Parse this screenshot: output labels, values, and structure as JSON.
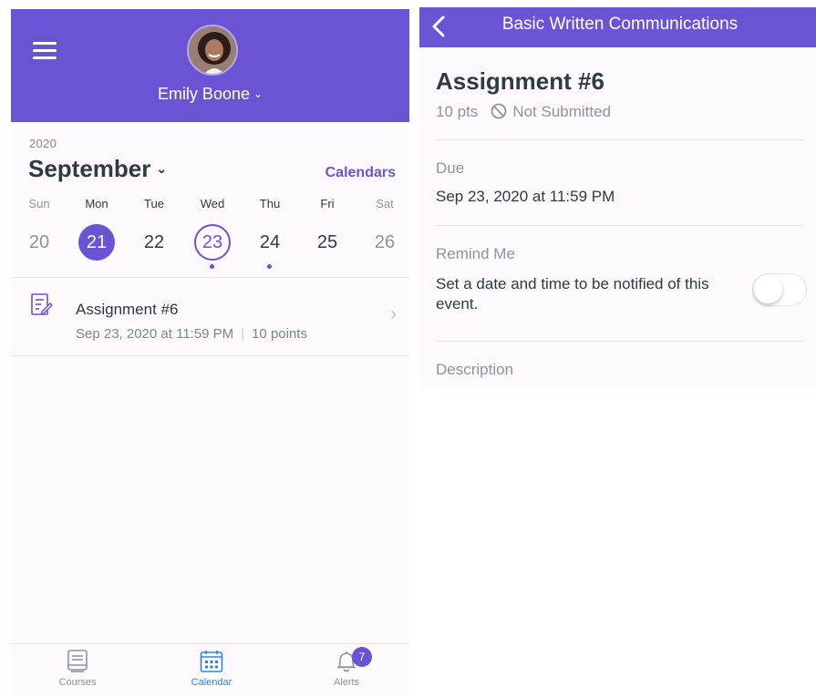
{
  "left": {
    "header": {
      "user_name": "Emily Boone"
    },
    "calendar": {
      "year": "2020",
      "month": "September",
      "calendars_link": "Calendars",
      "weekdays": [
        "Sun",
        "Mon",
        "Tue",
        "Wed",
        "Thu",
        "Fri",
        "Sat"
      ],
      "days": [
        "20",
        "21",
        "22",
        "23",
        "24",
        "25",
        "26"
      ],
      "selected_day": "21",
      "today_day": "23"
    },
    "event": {
      "title": "Assignment #6",
      "date": "Sep 23, 2020 at 11:59 PM",
      "points": "10 points"
    },
    "tabbar": {
      "tabs": [
        {
          "label": "Courses",
          "icon": "courses-icon",
          "active": false
        },
        {
          "label": "Calendar",
          "icon": "calendar-icon",
          "active": true
        },
        {
          "label": "Alerts",
          "icon": "bell-icon",
          "active": false,
          "badge": "7"
        }
      ]
    }
  },
  "right": {
    "header": {
      "title": "Basic Written Communications"
    },
    "assignment": {
      "title": "Assignment #6",
      "points": "10 pts",
      "status": "Not Submitted",
      "due_label": "Due",
      "due_value": "Sep 23, 2020 at 11:59 PM",
      "remind_label": "Remind Me",
      "remind_text": "Set a date and time to be notified of this event.",
      "remind_enabled": false,
      "description_label": "Description"
    }
  },
  "colors": {
    "brand": "#6a54d3",
    "text": "#2d3b45",
    "muted": "#8a959e",
    "active_tab": "#2b8ad6"
  }
}
